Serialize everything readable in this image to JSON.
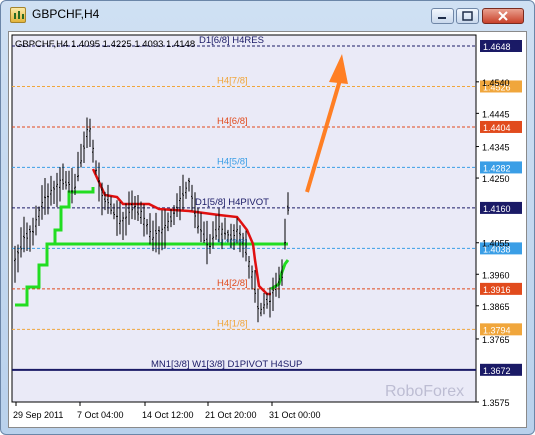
{
  "window": {
    "title": "GBPCHF,H4"
  },
  "chart_data": {
    "type": "candlestick",
    "symbol_info": "GBPCHF,H4  1.4095 1.4225 1.4093 1.4148",
    "watermark": "RoboForex",
    "colors": {
      "background": "#eaeaf7",
      "pivot_navy": "#1a1a66",
      "resistance": "#e14b1d",
      "support": "#f0a63c",
      "neutral": "#3a9ee6",
      "trend_green": "#22dd22",
      "trend_red": "#e01010",
      "arrow": "#ff7f24"
    },
    "price_axis": {
      "ticks": [
        "1.4540",
        "1.4445",
        "1.4345",
        "1.4250",
        "1.4055",
        "1.3960",
        "1.3865",
        "1.3765",
        "1.3575"
      ]
    },
    "date_axis": {
      "ticks": [
        "29 Sep 2011",
        "7 Oct 04:00",
        "14 Oct 12:00",
        "21 Oct 20:00",
        "31 Oct 00:00"
      ]
    },
    "levels": [
      {
        "price": "1.4648",
        "label": "D1[6/8] H4RES",
        "color": "#1a1a66",
        "style": "dashed"
      },
      {
        "price": "1.4526",
        "label": "H4[7/8]",
        "color": "#f0a63c",
        "style": "dashed"
      },
      {
        "price": "1.4404",
        "label": "H4[6/8]",
        "color": "#e14b1d",
        "style": "dashed"
      },
      {
        "price": "1.4282",
        "label": "H4[5/8]",
        "color": "#3a9ee6",
        "style": "dashed"
      },
      {
        "price": "1.4160",
        "label": "D1[5/8] H4PIVOT",
        "color": "#1a1a66",
        "style": "dashed"
      },
      {
        "price": "1.4038",
        "label": "H4[3/8]",
        "color": "#3a9ee6",
        "style": "dashed"
      },
      {
        "price": "1.3916",
        "label": "H4[2/8]",
        "color": "#e14b1d",
        "style": "dashed"
      },
      {
        "price": "1.3794",
        "label": "H4[1/8]",
        "color": "#f0a63c",
        "style": "dashed"
      },
      {
        "price": "1.3672",
        "label": "MN1[3/8] W1[3/8] D1PIVOT H4SUP",
        "color": "#1a1a66",
        "style": "solid"
      }
    ]
  }
}
